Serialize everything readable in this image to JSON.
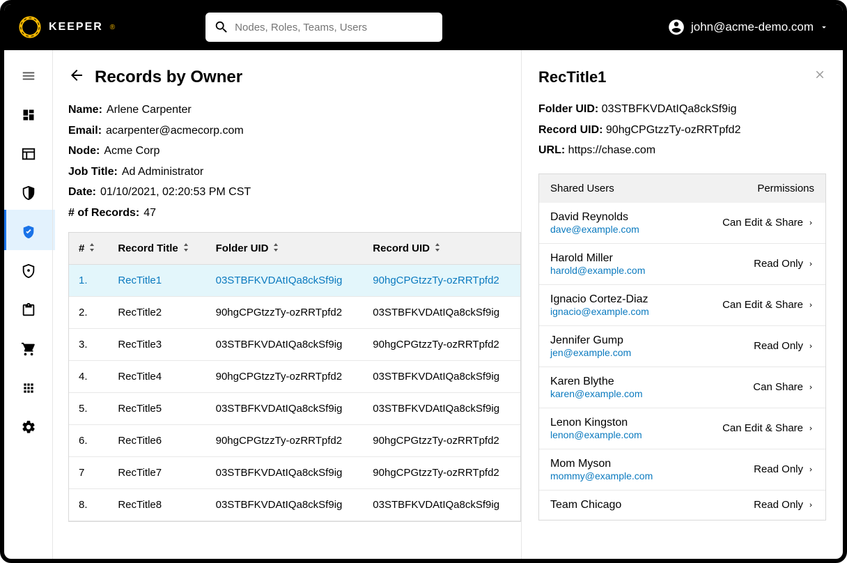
{
  "brand": {
    "name": "KEEPER"
  },
  "search": {
    "placeholder": "Nodes, Roles, Teams, Users"
  },
  "account": {
    "email": "john@acme-demo.com"
  },
  "page": {
    "title": "Records by Owner"
  },
  "owner": {
    "labels": {
      "name": "Name:",
      "email": "Email:",
      "node": "Node:",
      "job": "Job Title:",
      "date": "Date:",
      "count": "# of Records:"
    },
    "name": "Arlene Carpenter",
    "email": "acarpenter@acmecorp.com",
    "node": "Acme Corp",
    "job": "Ad Administrator",
    "date": "01/10/2021, 02:20:53 PM CST",
    "count": "47"
  },
  "columns": {
    "num": "#",
    "title": "Record Title",
    "folder": "Folder UID",
    "record": "Record UID"
  },
  "rows": [
    {
      "num": "1.",
      "title": "RecTitle1",
      "folder": "03STBFKVDAtIQa8ckSf9ig",
      "record": "90hgCPGtzzTy-ozRRTpfd2"
    },
    {
      "num": "2.",
      "title": "RecTitle2",
      "folder": "90hgCPGtzzTy-ozRRTpfd2",
      "record": "03STBFKVDAtIQa8ckSf9ig"
    },
    {
      "num": "3.",
      "title": "RecTitle3",
      "folder": "03STBFKVDAtIQa8ckSf9ig",
      "record": "90hgCPGtzzTy-ozRRTpfd2"
    },
    {
      "num": "4.",
      "title": "RecTitle4",
      "folder": "90hgCPGtzzTy-ozRRTpfd2",
      "record": "03STBFKVDAtIQa8ckSf9ig"
    },
    {
      "num": "5.",
      "title": "RecTitle5",
      "folder": "03STBFKVDAtIQa8ckSf9ig",
      "record": "03STBFKVDAtIQa8ckSf9ig"
    },
    {
      "num": "6.",
      "title": "RecTitle6",
      "folder": "90hgCPGtzzTy-ozRRTpfd2",
      "record": "90hgCPGtzzTy-ozRRTpfd2"
    },
    {
      "num": "7",
      "title": "RecTitle7",
      "folder": "03STBFKVDAtIQa8ckSf9ig",
      "record": "90hgCPGtzzTy-ozRRTpfd2"
    },
    {
      "num": "8.",
      "title": "RecTitle8",
      "folder": "03STBFKVDAtIQa8ckSf9ig",
      "record": "03STBFKVDAtIQa8ckSf9ig"
    }
  ],
  "detail": {
    "title": "RecTitle1",
    "labels": {
      "folder": "Folder UID:",
      "record": "Record UID:",
      "url": "URL:"
    },
    "folder": "03STBFKVDAtIQa8ckSf9ig",
    "record": "90hgCPGtzzTy-ozRRTpfd2",
    "url": "https://chase.com"
  },
  "shared": {
    "header": {
      "users": "Shared Users",
      "perms": "Permissions"
    },
    "rows": [
      {
        "name": "David Reynolds",
        "email": "dave@example.com",
        "perm": "Can Edit & Share"
      },
      {
        "name": "Harold Miller",
        "email": "harold@example.com",
        "perm": "Read Only"
      },
      {
        "name": "Ignacio Cortez-Diaz",
        "email": "ignacio@example.com",
        "perm": "Can Edit & Share"
      },
      {
        "name": "Jennifer Gump",
        "email": "jen@example.com",
        "perm": "Read Only"
      },
      {
        "name": "Karen Blythe",
        "email": "karen@example.com",
        "perm": "Can Share"
      },
      {
        "name": "Lenon Kingston",
        "email": "lenon@example.com",
        "perm": "Can Edit & Share"
      },
      {
        "name": "Mom Myson",
        "email": "mommy@example.com",
        "perm": "Read Only"
      },
      {
        "name": "Team Chicago",
        "email": "",
        "perm": "Read Only"
      }
    ]
  }
}
